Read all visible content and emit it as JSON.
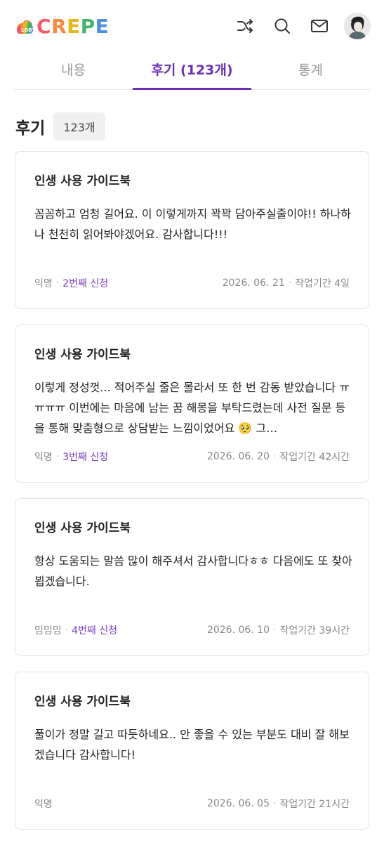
{
  "header": {
    "logo_text": [
      "C",
      "R",
      "E",
      "P",
      "E"
    ],
    "icons": [
      "shuffle-icon",
      "search-icon",
      "mail-icon"
    ]
  },
  "tabs": [
    {
      "label": "내용",
      "active": false
    },
    {
      "label": "후기 (123개)",
      "active": true
    },
    {
      "label": "통계",
      "active": false
    }
  ],
  "section": {
    "title": "후기",
    "count": "123개"
  },
  "reviews": [
    {
      "title": "인생 사용 가이드북",
      "body": "꼼꼼하고 엄청 길어요. 이 이렇게까지 꽉꽉 담아주실줄이야!! 하나하나 천천히 읽어봐야겠어요. 감사합니다!!!",
      "author": "익명",
      "order": "2번째 신청",
      "date": "2026. 06. 21",
      "duration": "작업기간 4일"
    },
    {
      "title": "인생 사용 가이드북",
      "body": "이렇게 정성껏... 적어주실 줄은 몰라서 또 한 번 감동 받았습니다 ㅠㅠㅠㅠ 이번에는 마음에 남는 꿈 해몽을 부탁드렸는데 사전 질문 등을 통해 맞춤형으로 상담받는 느낌이었어요 🥺 그…",
      "author": "익명",
      "order": "3번째 신청",
      "date": "2026. 06. 20",
      "duration": "작업기간 42시간"
    },
    {
      "title": "인생 사용 가이드북",
      "body": "항상 도움되는 말씀 많이 해주셔서 감사합니다ㅎㅎ 다음에도 또 찾아뵙겠습니다.",
      "author": "밈밈밈",
      "order": "4번째 신청",
      "date": "2026. 06. 10",
      "duration": "작업기간 39시간"
    },
    {
      "title": "인생 사용 가이드북",
      "body": "풀이가 정말 길고 따듯하네요.. 안 좋을 수 있는 부분도 대비 잘 해보겠습니다 감사합니다!",
      "author": "익명",
      "order": "",
      "date": "2026. 06. 05",
      "duration": "작업기간 21시간"
    }
  ]
}
